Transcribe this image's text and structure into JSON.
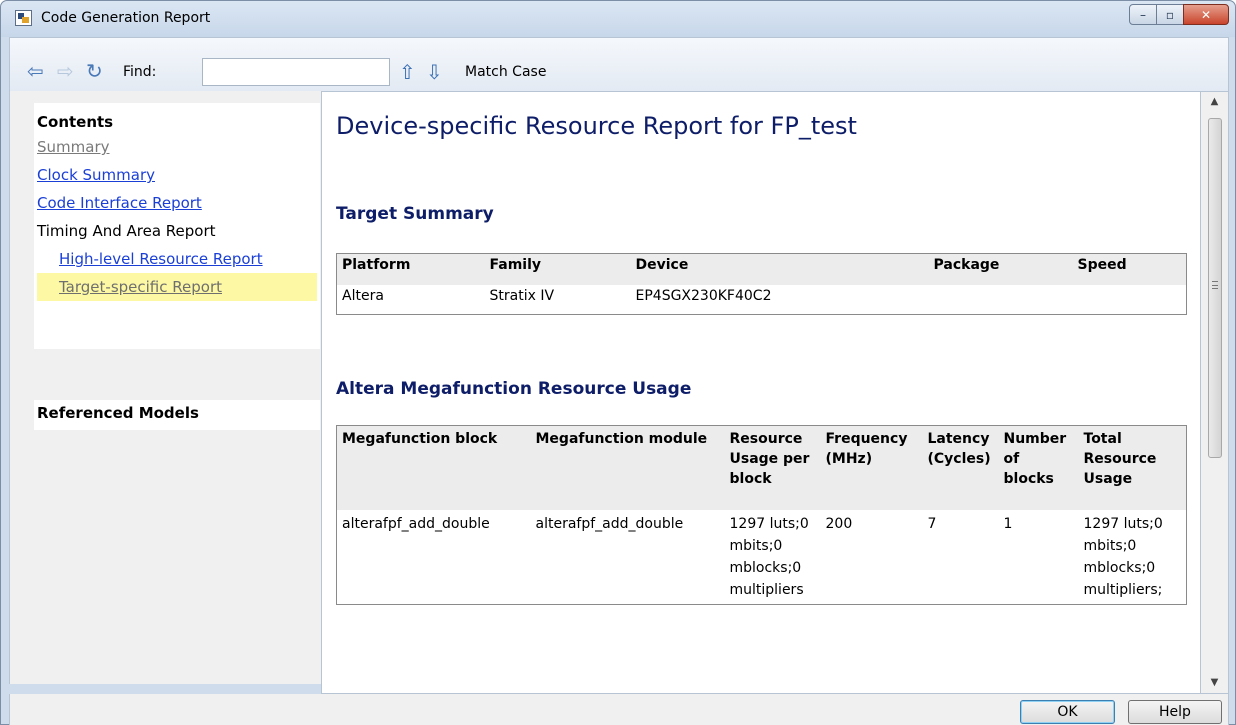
{
  "window": {
    "title": "Code Generation Report"
  },
  "titlebar": {
    "min_label": "–",
    "max_label": "▫",
    "close_label": "✕"
  },
  "toolbar": {
    "find_label": "Find:",
    "find_value": "",
    "match_case_label": "Match Case",
    "icons": [
      "back-arrow-icon",
      "forward-arrow-icon",
      "refresh-icon",
      "up-arrow-icon",
      "down-arrow-icon"
    ]
  },
  "sidebar": {
    "contents_title": "Contents",
    "items": [
      {
        "label": "Summary"
      },
      {
        "label": "Clock Summary"
      },
      {
        "label": "Code Interface Report"
      },
      {
        "label": "Timing And Area Report"
      },
      {
        "label": "High-level Resource Report"
      },
      {
        "label": "Target-specific Report"
      }
    ],
    "referenced_models_title": "Referenced Models"
  },
  "main": {
    "title": "Device-specific Resource Report for FP_test",
    "target_summary": {
      "heading": "Target Summary",
      "headers": [
        "Platform",
        "Family",
        "Device",
        "Package",
        "Speed"
      ],
      "rows": [
        [
          "Altera",
          "Stratix IV",
          "EP4SGX230KF40C2",
          "",
          ""
        ]
      ]
    },
    "megafunction_usage": {
      "heading": "Altera Megafunction Resource Usage",
      "headers": [
        "Megafunction block",
        "Megafunction module",
        "Resource Usage per block",
        "Frequency (MHz)",
        "Latency (Cycles)",
        "Number of blocks",
        "Total Resource Usage"
      ],
      "rows": [
        [
          "alterafpf_add_double",
          "alterafpf_add_double",
          "1297 luts;0 mbits;0 mblocks;0 multipliers",
          "200",
          "7",
          "1",
          "1297 luts;0 mbits;0 mblocks;0 multipliers;"
        ]
      ]
    }
  },
  "footer": {
    "ok_label": "OK",
    "help_label": "Help"
  },
  "colors": {
    "heading": "#0e1d68",
    "link": "#1a3fd6",
    "visited_link": "#7a7a7a",
    "highlight": "#fdf8a3"
  }
}
